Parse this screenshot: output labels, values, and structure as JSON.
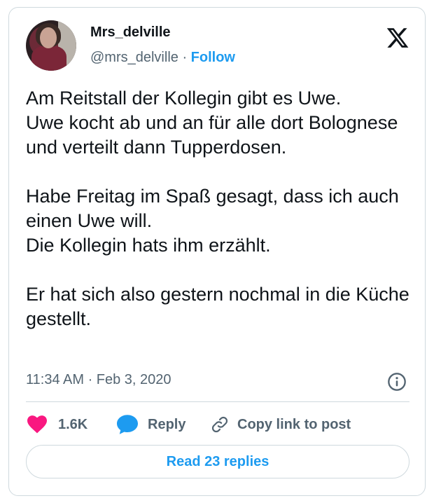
{
  "author": {
    "name": "Mrs_delville",
    "handle": "@mrs_delville",
    "separator": " · ",
    "follow_label": "Follow"
  },
  "tweet": {
    "text": "Am Reitstall der Kollegin gibt es Uwe.\nUwe kocht ab und an für alle dort Bolognese und verteilt dann Tupperdosen.\n\nHabe Freitag im Spaß gesagt, dass ich auch einen Uwe will.\nDie Kollegin hats ihm erzählt.\n\nEr hat sich also gestern nochmal in die Küche gestellt.",
    "timestamp": "11:34 AM · Feb 3, 2020"
  },
  "actions": {
    "likes_count": "1.6K",
    "reply_label": "Reply",
    "copy_link_label": "Copy link to post"
  },
  "footer": {
    "read_replies_label": "Read 23 replies"
  },
  "icons": {
    "logo": "x-logo-icon",
    "info": "info-icon",
    "like": "heart-icon",
    "reply": "speech-bubble-icon",
    "copy": "link-icon"
  },
  "colors": {
    "accent": "#1d9bf0",
    "like": "#f91880",
    "text": "#0f1419",
    "muted": "#536471",
    "border": "#cfd9de"
  }
}
